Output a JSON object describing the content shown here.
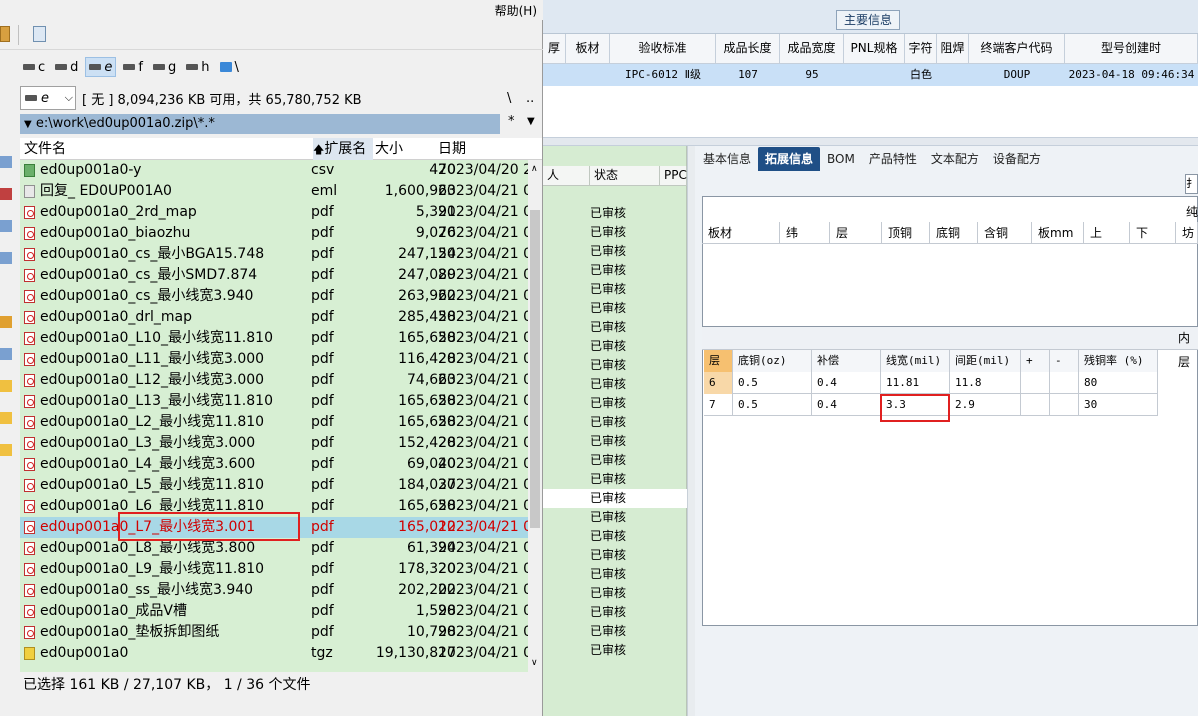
{
  "fm": {
    "menu_help": "帮助(H)",
    "drives": [
      {
        "label": "c"
      },
      {
        "label": "d"
      },
      {
        "label": "e",
        "selected": true
      },
      {
        "label": "f"
      },
      {
        "label": "g"
      },
      {
        "label": "h"
      },
      {
        "label": "\\"
      }
    ],
    "drive_combo": "e",
    "disk_info": "[ 无 ]  8,094,236 KB 可用，共 65,780,752 KB",
    "nav_root": "\\",
    "nav_up": "..",
    "path": "e:\\work\\ed0up001a0.zip\\*.*",
    "path_star": "*",
    "columns": {
      "name": "文件名",
      "ext": "扩展名",
      "size": "大小",
      "date": "日期"
    },
    "files": [
      {
        "name": "ed0up001a0-y",
        "ext": "csv",
        "size": "470",
        "date": "2023/04/20 2",
        "type": "csv"
      },
      {
        "name": "回复_ ED0UP001A0",
        "ext": "eml",
        "size": "1,600,963",
        "date": "2023/04/21 0",
        "type": "eml"
      },
      {
        "name": "ed0up001a0_2rd_map",
        "ext": "pdf",
        "size": "5,391",
        "date": "2023/04/21 0",
        "type": "pdf"
      },
      {
        "name": "ed0up001a0_biaozhu",
        "ext": "pdf",
        "size": "9,076",
        "date": "2023/04/21 0",
        "type": "pdf"
      },
      {
        "name": "ed0up001a0_cs_最小BGA15.748",
        "ext": "pdf",
        "size": "247,154",
        "date": "2023/04/21 0",
        "type": "pdf"
      },
      {
        "name": "ed0up001a0_cs_最小SMD7.874",
        "ext": "pdf",
        "size": "247,089",
        "date": "2023/04/21 0",
        "type": "pdf"
      },
      {
        "name": "ed0up001a0_cs_最小线宽3.940",
        "ext": "pdf",
        "size": "263,962",
        "date": "2023/04/21 0",
        "type": "pdf"
      },
      {
        "name": "ed0up001a0_drl_map",
        "ext": "pdf",
        "size": "285,458",
        "date": "2023/04/21 0",
        "type": "pdf"
      },
      {
        "name": "ed0up001a0_L10_最小线宽11.810",
        "ext": "pdf",
        "size": "165,658",
        "date": "2023/04/21 0",
        "type": "pdf"
      },
      {
        "name": "ed0up001a0_L11_最小线宽3.000",
        "ext": "pdf",
        "size": "116,428",
        "date": "2023/04/21 0",
        "type": "pdf"
      },
      {
        "name": "ed0up001a0_L12_最小线宽3.000",
        "ext": "pdf",
        "size": "74,663",
        "date": "2023/04/21 0",
        "type": "pdf"
      },
      {
        "name": "ed0up001a0_L13_最小线宽11.810",
        "ext": "pdf",
        "size": "165,658",
        "date": "2023/04/21 0",
        "type": "pdf"
      },
      {
        "name": "ed0up001a0_L2_最小线宽11.810",
        "ext": "pdf",
        "size": "165,658",
        "date": "2023/04/21 0",
        "type": "pdf"
      },
      {
        "name": "ed0up001a0_L3_最小线宽3.000",
        "ext": "pdf",
        "size": "152,428",
        "date": "2023/04/21 0",
        "type": "pdf"
      },
      {
        "name": "ed0up001a0_L4_最小线宽3.600",
        "ext": "pdf",
        "size": "69,040",
        "date": "2023/04/21 0",
        "type": "pdf"
      },
      {
        "name": "ed0up001a0_L5_最小线宽11.810",
        "ext": "pdf",
        "size": "184,037",
        "date": "2023/04/21 0",
        "type": "pdf"
      },
      {
        "name": "ed0up001a0_L6_最小线宽11.810",
        "ext": "pdf",
        "size": "165,658",
        "date": "2023/04/21 0",
        "type": "pdf"
      },
      {
        "name": "ed0up001a0_L7_最小线宽3.001",
        "ext": "pdf",
        "size": "165,012",
        "date": "2023/04/21 0",
        "type": "pdf",
        "selected": true
      },
      {
        "name": "ed0up001a0_L8_最小线宽3.800",
        "ext": "pdf",
        "size": "61,394",
        "date": "2023/04/21 0",
        "type": "pdf"
      },
      {
        "name": "ed0up001a0_L9_最小线宽11.810",
        "ext": "pdf",
        "size": "178,320",
        "date": "2023/04/21 0",
        "type": "pdf"
      },
      {
        "name": "ed0up001a0_ss_最小线宽3.940",
        "ext": "pdf",
        "size": "202,202",
        "date": "2023/04/21 0",
        "type": "pdf"
      },
      {
        "name": "ed0up001a0_成品V槽",
        "ext": "pdf",
        "size": "1,598",
        "date": "2023/04/21 0",
        "type": "pdf"
      },
      {
        "name": "ed0up001a0_垫板拆卸图纸",
        "ext": "pdf",
        "size": "10,798",
        "date": "2023/04/21 0",
        "type": "pdf"
      },
      {
        "name": "ed0up001a0",
        "ext": "tgz",
        "size": "19,130,817",
        "date": "2023/04/21 0",
        "type": "tgz"
      }
    ],
    "status": "已选择 161 KB / 27,107 KB， 1 / 36 个文件"
  },
  "erp": {
    "main_info": "主要信息",
    "head_cols": [
      "厚",
      "板材",
      "验收标准",
      "成品长度",
      "成品宽度",
      "PNL规格",
      "字符",
      "阻焊",
      "终端客户代码",
      "型号创建时"
    ],
    "row_cells": [
      "",
      "",
      "IPC-6012 Ⅱ级",
      "107",
      "95",
      "",
      "白色",
      "",
      "DOUP",
      "2023-04-18 09:46:34"
    ],
    "left_headers": [
      "人",
      "状态",
      "PPC"
    ],
    "left_status": [
      "已审核",
      "已审核",
      "已审核",
      "已审核",
      "已审核",
      "已审核",
      "已审核",
      "已审核",
      "已审核",
      "已审核",
      "已审核",
      "已审核",
      "已审核",
      "已审核",
      "已审核",
      "已审核",
      "已审核",
      "已审核",
      "已审核",
      "已审核",
      "已审核",
      "已审核",
      "已审核",
      "已审核"
    ],
    "tabs": [
      "基本信息",
      "拓展信息",
      "BOM",
      "产品特性",
      "文本配方",
      "设备配方"
    ],
    "tab_active": 1,
    "tab_btn": "扌",
    "grid1_caption": "纯",
    "grid1_cols": [
      "板材",
      "纬",
      "层",
      "顶铜",
      "底铜",
      "含铜",
      "板mm",
      "上",
      "下",
      "坊"
    ],
    "grid2_caption": "内层",
    "grid2_head": [
      "层",
      "底铜(oz)",
      "补偿",
      "线宽(mil)",
      "间距(mil)",
      "+",
      "-",
      "残铜率 (%)"
    ],
    "grid2_rows": [
      [
        "6",
        "0.5",
        "0.4",
        "11.81",
        "11.8",
        "",
        "",
        "80"
      ],
      [
        "7",
        "0.5",
        "0.4",
        "3.3",
        "2.9",
        "",
        "",
        "30"
      ]
    ]
  }
}
